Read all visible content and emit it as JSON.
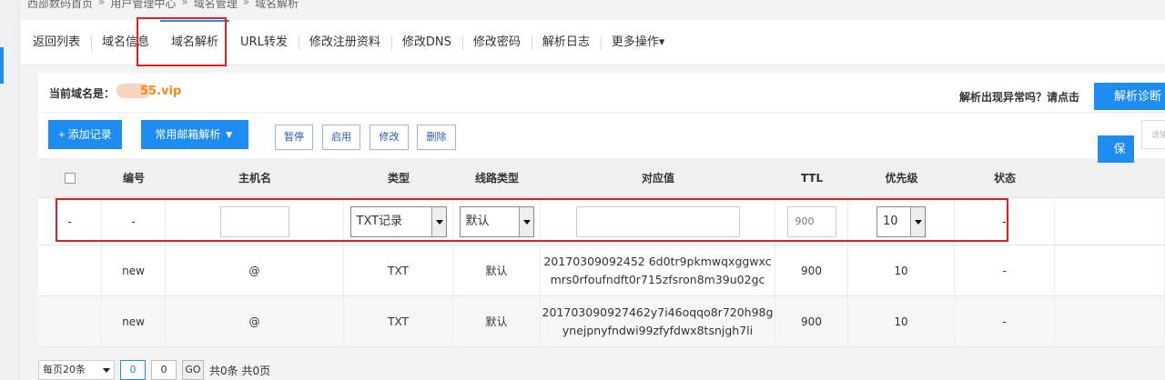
{
  "breadcrumb": [
    "西部数码首页",
    "用户管理中心",
    "域名管理",
    "域名解析"
  ],
  "tabs": [
    "返回列表",
    "域名信息",
    "域名解析",
    "URL转发",
    "修改注册资料",
    "修改DNS",
    "修改密码",
    "解析日志",
    "更多操作▾"
  ],
  "active_tab": "域名解析",
  "domain": {
    "label": "当前域名是：",
    "value": "55.vip"
  },
  "diagnose": {
    "text": "解析出现异常吗？请点击",
    "button": "解析诊断"
  },
  "toolbar": {
    "add": "+ 添加记录",
    "mail": "常用邮箱解析",
    "pause": "暂停",
    "start": "启用",
    "edit": "修改",
    "delete": "删除",
    "search_placeholder": "请输"
  },
  "table": {
    "headers": [
      "",
      "编号",
      "主机名",
      "类型",
      "线路类型",
      "对应值",
      "TTL",
      "优先级",
      "状态"
    ],
    "edit_row": {
      "col0": "-",
      "col1": "-",
      "type": "TXT记录",
      "line": "默认",
      "ttl": "900",
      "priority": "10",
      "status": "-",
      "save": "保"
    },
    "rows": [
      {
        "id": "new",
        "host": "@",
        "type": "TXT",
        "line": "默认",
        "value_1": "20170309092452 6d0tr9pkmwqxggwxc",
        "value_2": "mrs0rfoufndft0r715zfsron8m39u02gc",
        "ttl": "900",
        "priority": "10",
        "status": "-"
      },
      {
        "id": "new",
        "host": "@",
        "type": "TXT",
        "line": "默认",
        "value_1": "201703090927462y7i46oqqo8r720h98g",
        "value_2": "ynejpnyfndwi99zfyfdwx8tsnjgh7li",
        "ttl": "900",
        "priority": "10",
        "status": "-"
      }
    ]
  },
  "pager": {
    "page_size": "每页20条",
    "current": "0",
    "total_input": "0",
    "go": "GO",
    "summary": "共0条 共0页"
  },
  "colors": {
    "accent": "#1e8cf0",
    "domain": "#f08a1c",
    "highlight": "#e02020"
  }
}
